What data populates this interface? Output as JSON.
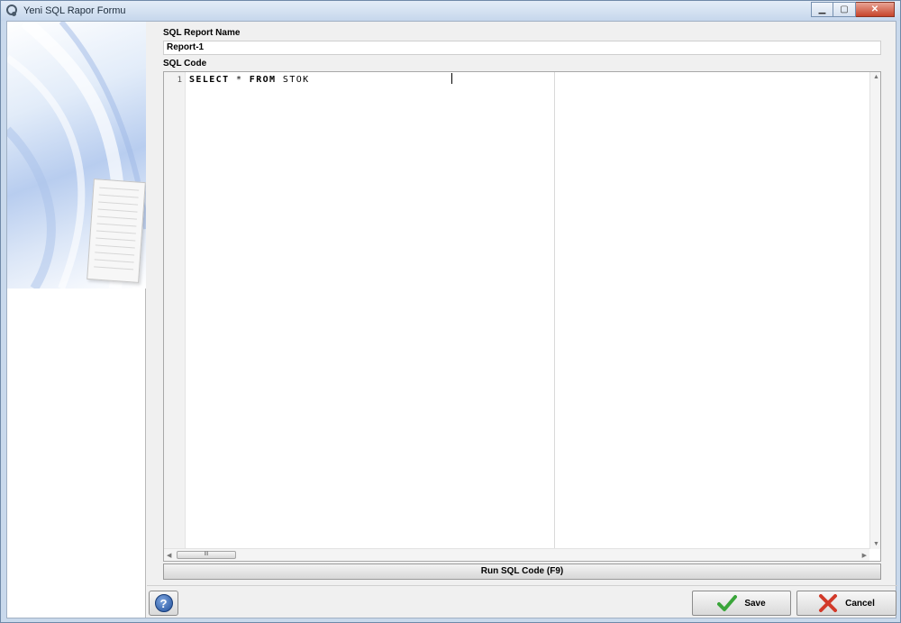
{
  "window": {
    "title": "Yeni SQL Rapor Formu",
    "controls": {
      "minimize": "▁",
      "maximize": "▢",
      "close": "✕"
    }
  },
  "form": {
    "report_name_label": "SQL Report Name",
    "report_name_value": "Report-1",
    "sql_code_label": "SQL Code",
    "editor": {
      "line_number": "1",
      "keyword_select": "SELECT",
      "operator_star": "*",
      "keyword_from": "FROM",
      "table_name": "STOK"
    },
    "scrollbar_thumb_grip": "III",
    "run_button_label": "Run SQL Code (F9)"
  },
  "footer": {
    "help_label": "?",
    "save_label": "Save",
    "cancel_label": "Cancel"
  },
  "colors": {
    "accent_blue": "#1f4e9a",
    "save_green": "#3aa53a",
    "cancel_red": "#d23a2a"
  },
  "icons": [
    "app-icon",
    "help-icon",
    "check-icon",
    "cross-icon",
    "document-illustration"
  ]
}
